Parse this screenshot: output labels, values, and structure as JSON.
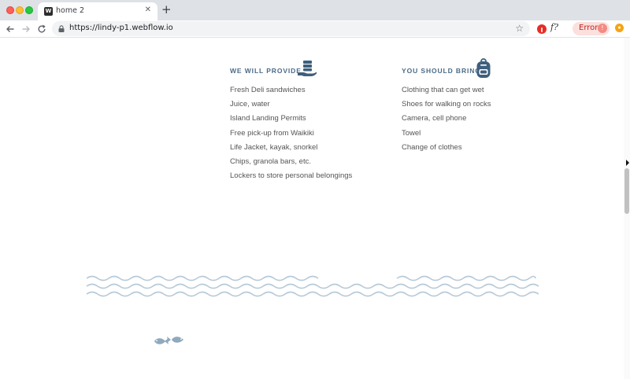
{
  "browser": {
    "tab_title": "home 2",
    "tab_favicon_letter": "W",
    "url": "https://lindy-p1.webflow.io",
    "error_label": "Error",
    "error_count": "!",
    "ext_f_label": "f?"
  },
  "provide": {
    "title": "WE WILL PROVIDE",
    "icon": "hand-giving-icon",
    "items": [
      "Fresh Deli sandwiches",
      "Juice, water",
      "Island Landing Permits",
      "Free pick-up from Waikiki",
      "Life Jacket, kayak, snorkel",
      "Chips, granola bars, etc.",
      "Lockers to store personal belongings"
    ]
  },
  "bring": {
    "title": "YOU SHOULD BRING",
    "icon": "backpack-icon",
    "items": [
      "Clothing that can get wet",
      "Shoes for walking on rocks",
      "Camera, cell phone",
      "Towel",
      "Change of clothes"
    ]
  },
  "colors": {
    "heading": "#4b6b87",
    "icon": "#3e5f7d",
    "wave": "#b7cad8",
    "body_text": "#555555"
  }
}
